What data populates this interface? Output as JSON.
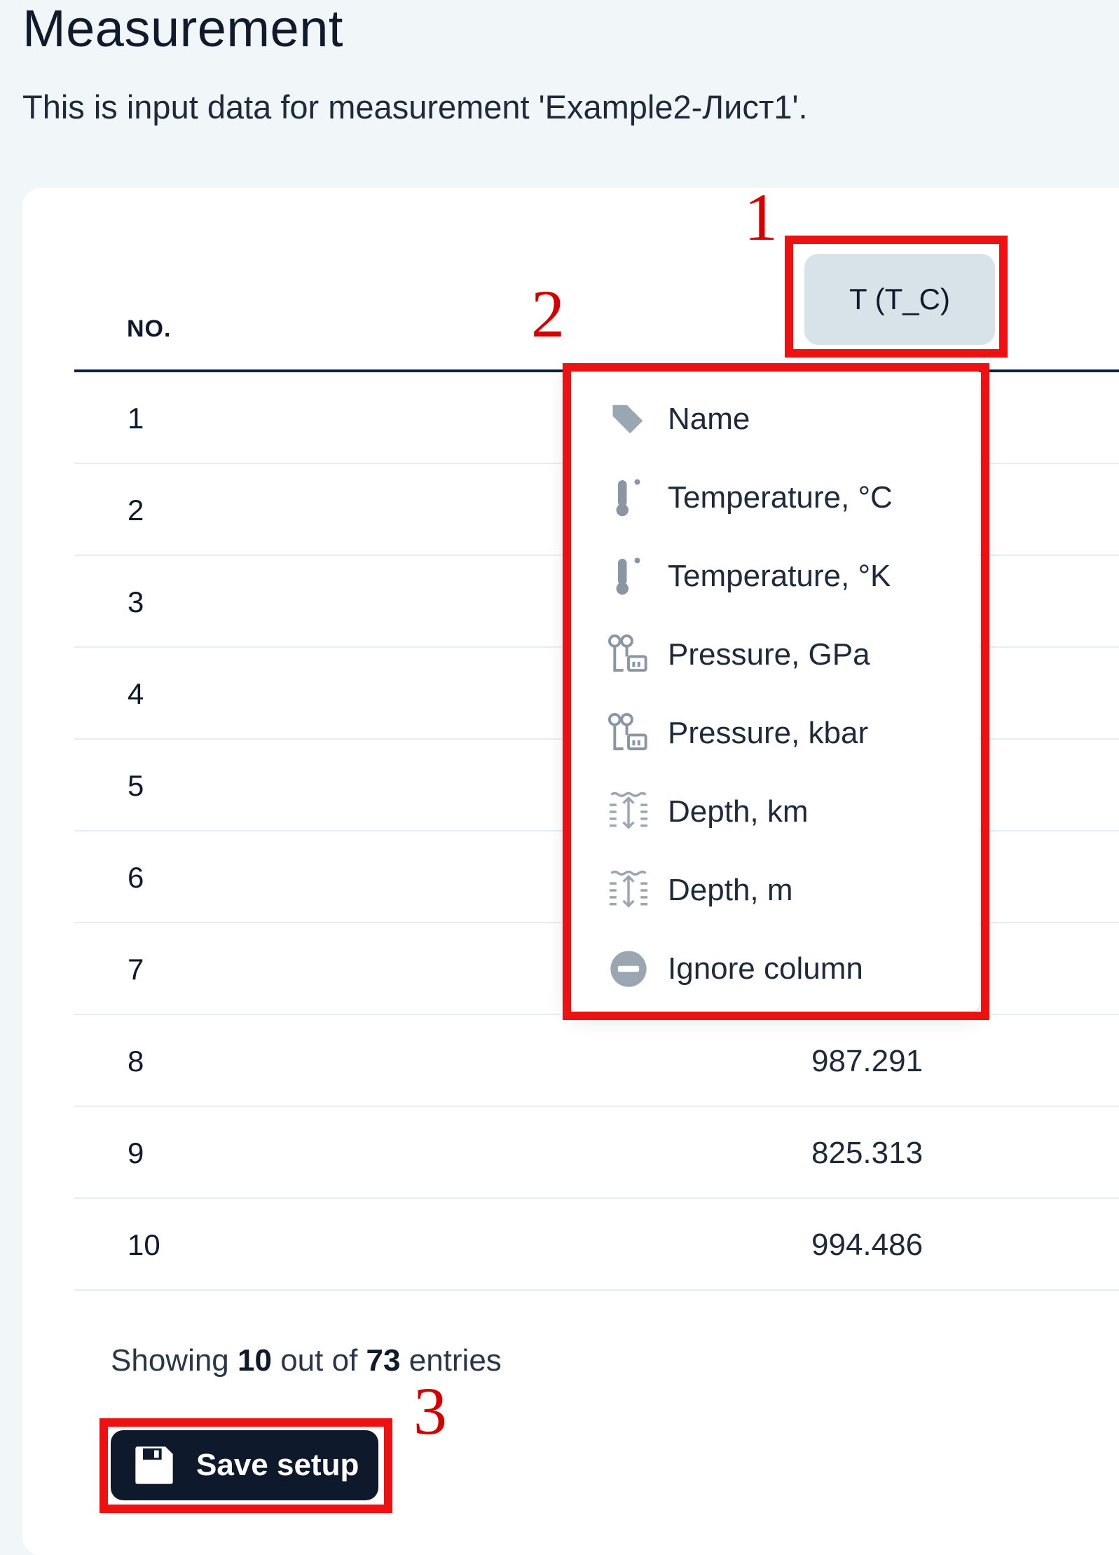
{
  "page": {
    "title": "Measurement",
    "subtitle": "This is input data for measurement 'Example2-Лист1'."
  },
  "table": {
    "no_header": "NO.",
    "column_button_label": "T (T_C)",
    "rows": [
      {
        "no": "1",
        "value": ""
      },
      {
        "no": "2",
        "value": ""
      },
      {
        "no": "3",
        "value": ""
      },
      {
        "no": "4",
        "value": ""
      },
      {
        "no": "5",
        "value": ""
      },
      {
        "no": "6",
        "value": ""
      },
      {
        "no": "7",
        "value": ""
      },
      {
        "no": "8",
        "value": "987.291"
      },
      {
        "no": "9",
        "value": "825.313"
      },
      {
        "no": "10",
        "value": "994.486"
      }
    ]
  },
  "dropdown": {
    "items": [
      {
        "label": "Name",
        "icon": "tag-icon"
      },
      {
        "label": "Temperature, °C",
        "icon": "thermometer-icon"
      },
      {
        "label": "Temperature, °K",
        "icon": "thermometer-icon"
      },
      {
        "label": "Pressure, GPa",
        "icon": "pressure-gauge-icon"
      },
      {
        "label": "Pressure, kbar",
        "icon": "pressure-gauge-icon"
      },
      {
        "label": "Depth, km",
        "icon": "depth-icon"
      },
      {
        "label": "Depth, m",
        "icon": "depth-icon"
      },
      {
        "label": "Ignore column",
        "icon": "minus-circle-icon"
      }
    ]
  },
  "footer": {
    "showing_prefix": "Showing",
    "shown_count": "10",
    "out_of_text": "out of",
    "total_count": "73",
    "entries_text": "entries",
    "save_label": "Save setup",
    "save_icon": "floppy-disk-icon"
  },
  "annotations": {
    "color": "#ee1111",
    "labels": [
      "1",
      "2",
      "3"
    ]
  },
  "colors": {
    "background": "#f1f6f8",
    "card": "#ffffff",
    "column_button": "#d7e3e9",
    "save_button": "#0e1a2b",
    "icon_gray": "#9aa6b2"
  }
}
